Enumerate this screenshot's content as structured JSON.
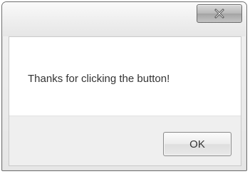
{
  "dialog": {
    "close_icon": "close-icon",
    "message": "Thanks for clicking the button!",
    "ok_label": "OK"
  }
}
